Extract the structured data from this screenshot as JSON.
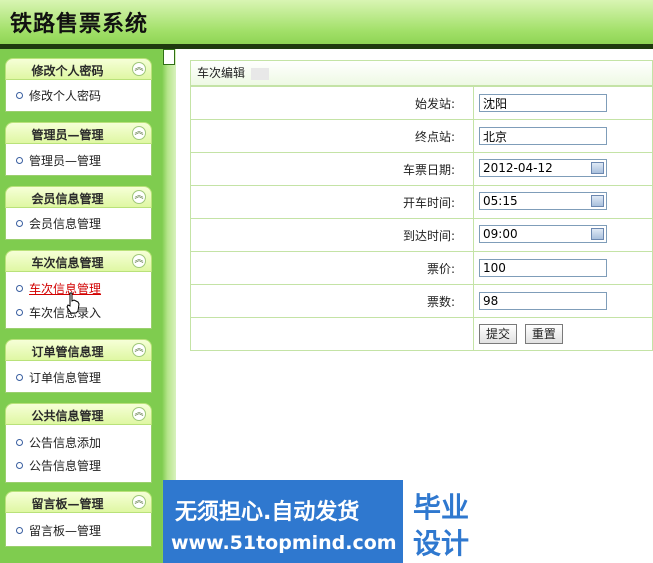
{
  "app": {
    "title": "铁路售票系统"
  },
  "sidebar": {
    "groups": [
      {
        "title": "修改个人密码",
        "items": [
          "修改个人密码"
        ]
      },
      {
        "title": "管理员—管理",
        "items": [
          "管理员—管理"
        ]
      },
      {
        "title": "会员信息管理",
        "items": [
          "会员信息管理"
        ]
      },
      {
        "title": "车次信息管理",
        "items": [
          "车次信息管理",
          "车次信息录入"
        ]
      },
      {
        "title": "订单管信息理",
        "items": [
          "订单信息管理"
        ]
      },
      {
        "title": "公共信息管理",
        "items": [
          "公告信息添加",
          "公告信息管理"
        ]
      },
      {
        "title": "留言板—管理",
        "items": [
          "留言板—管理"
        ]
      }
    ],
    "collapse_glyph": "︽"
  },
  "form": {
    "title": "车次编辑",
    "fields": {
      "start": {
        "label": "始发站:",
        "value": "沈阳"
      },
      "end": {
        "label": "终点站:",
        "value": "北京"
      },
      "date": {
        "label": "车票日期:",
        "value": "2012-04-12"
      },
      "depart": {
        "label": "开车时间:",
        "value": "05:15"
      },
      "arrive": {
        "label": "到达时间:",
        "value": "09:00"
      },
      "price": {
        "label": "票价:",
        "value": "100"
      },
      "count": {
        "label": "票数:",
        "value": "98"
      }
    },
    "submit": "提交",
    "reset": "重置"
  },
  "watermark": {
    "line1": "无须担心.自动发货",
    "line2": "www.51topmind.com",
    "box1": "毕业",
    "box2": "设计"
  },
  "colors": {
    "header": "#a2e069",
    "sidebar": "#7fcc4f",
    "watermark": "#2f78cf",
    "active_link": "#d20000"
  }
}
